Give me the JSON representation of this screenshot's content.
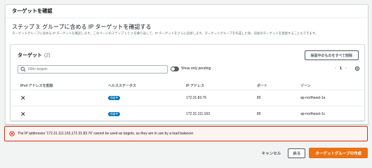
{
  "panel": {
    "header": "ターゲットを確認"
  },
  "step": {
    "title": "ステップ 3: グループに含める IP ターゲットを確認する",
    "description": "ターゲットグループに含める IP ターゲットを確認します。このページのステップ 1 と 2 を繰り返して、IP ターゲットをさらに追加します。ターゲットグループを作成した後、追加のターゲットを登録することもできます。"
  },
  "targets": {
    "title": "ターゲット",
    "count": "(2)",
    "remove_all_label": "保留中のものをすべて削除",
    "search_placeholder": "Filter targets",
    "toggle_label": "Show only pending",
    "pager": {
      "prev": "‹",
      "page": "1",
      "next": "›"
    },
    "columns": [
      "IPv4 アドレスを削除",
      "ヘルスステータス",
      "IP アドレス",
      "ポート",
      "ゾーン"
    ],
    "rows": [
      {
        "status": "保留中",
        "ip": "172.31.83.76",
        "port": "80",
        "zone": "ap-northeast-1a"
      },
      {
        "status": "保留中",
        "ip": "172.31.111.163",
        "port": "80",
        "zone": "ap-northeast-1c"
      }
    ]
  },
  "error": {
    "message": "The IP addresses '172.31.111.163,172.31.83.76' cannot be used as targets, as they are in use by a load balancer"
  },
  "footer": {
    "cancel": "キャンセル",
    "prev": "戻る",
    "create": "ターゲットグループの作成"
  },
  "colors": {
    "accent": "#ec7211",
    "badge": "#0073bb",
    "error_border": "#d13212",
    "error_bg": "#fdf3f1"
  }
}
